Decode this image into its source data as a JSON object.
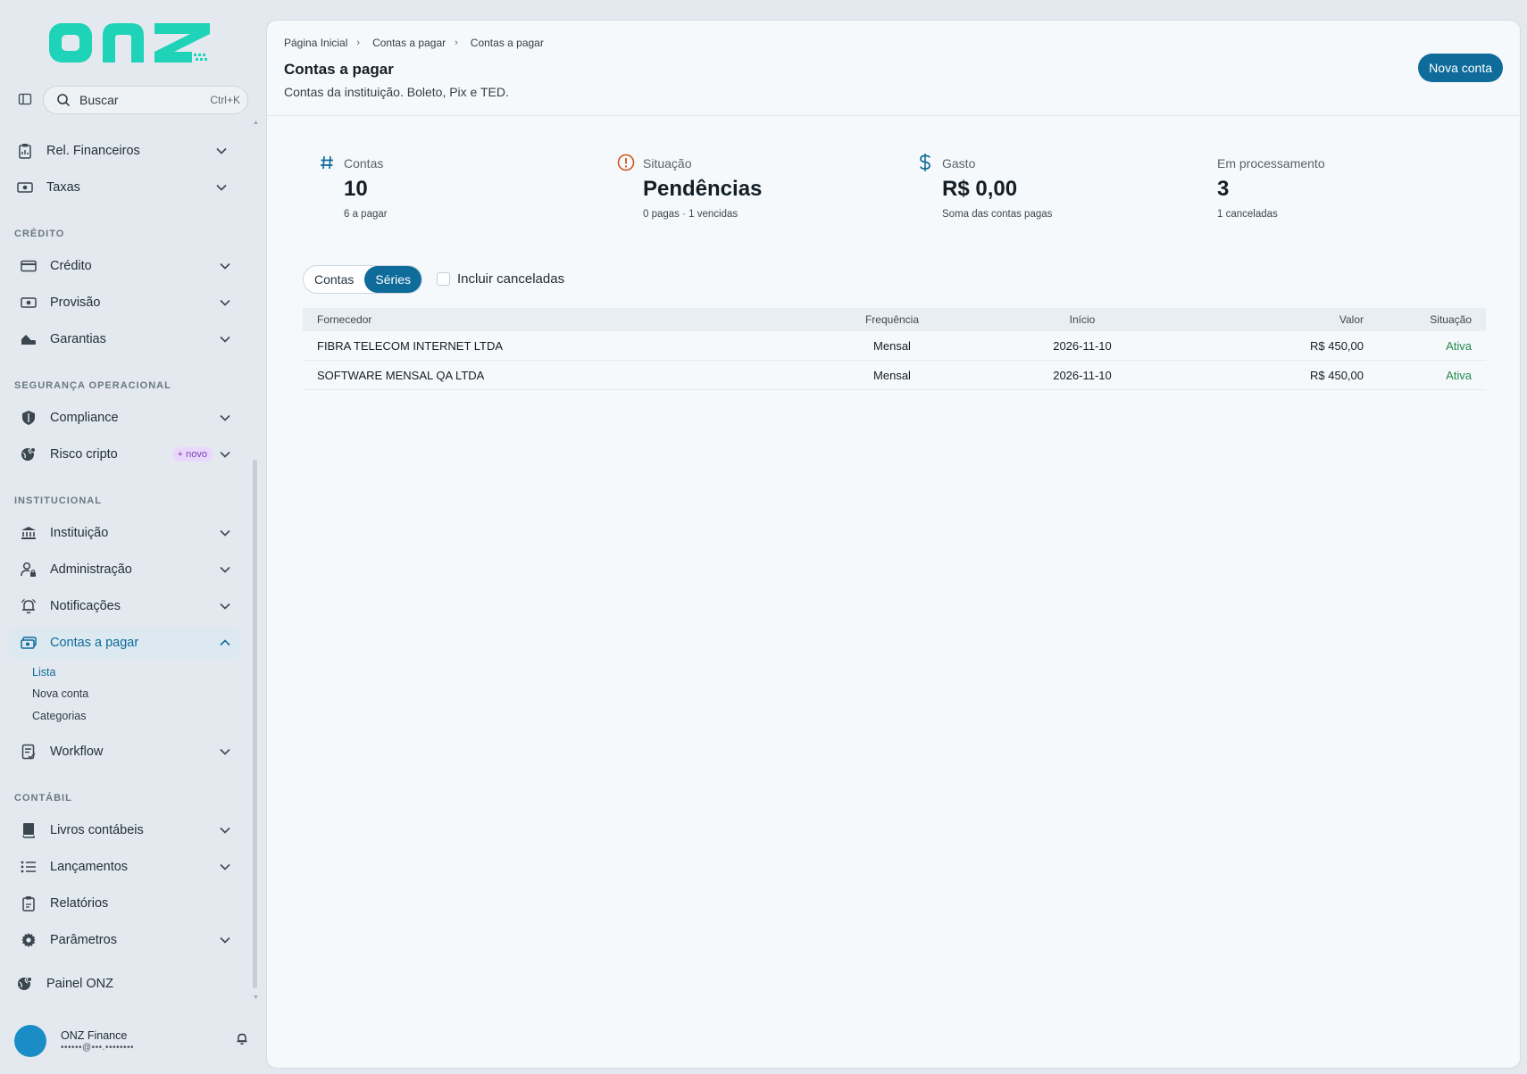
{
  "brand": {
    "logo_text": "onz",
    "accent": "#1fd3b9"
  },
  "search": {
    "label": "Buscar",
    "shortcut": "Ctrl+K"
  },
  "sidebar": {
    "items": [
      {
        "label": "Rel. Financeiros",
        "icon": "report-icon"
      },
      {
        "label": "Taxas",
        "icon": "money-icon"
      },
      {
        "label": "Crédito",
        "icon": "card-icon"
      },
      {
        "label": "Provisão",
        "icon": "money-icon"
      },
      {
        "label": "Garantias",
        "icon": "car-home-icon"
      },
      {
        "label": "Compliance",
        "icon": "shield-icon"
      },
      {
        "label": "Risco cripto",
        "icon": "globe-icon",
        "badge": "+ novo"
      },
      {
        "label": "Instituição",
        "icon": "bank-icon"
      },
      {
        "label": "Administração",
        "icon": "user-lock-icon"
      },
      {
        "label": "Notificações",
        "icon": "bell-icon"
      },
      {
        "label": "Contas a pagar",
        "icon": "bill-icon"
      },
      {
        "label": "Workflow",
        "icon": "checklist-icon"
      },
      {
        "label": "Livros contábeis",
        "icon": "book-icon"
      },
      {
        "label": "Lançamentos",
        "icon": "list-icon"
      },
      {
        "label": "Relatórios",
        "icon": "clipboard-icon"
      },
      {
        "label": "Parâmetros",
        "icon": "gear-icon"
      },
      {
        "label": "Painel ONZ",
        "icon": "globe-icon"
      }
    ],
    "sections": [
      "CRÉDITO",
      "SEGURANÇA OPERACIONAL",
      "INSTITUCIONAL",
      "CONTÁBIL"
    ],
    "sub_items": [
      "Lista",
      "Nova conta",
      "Categorias"
    ]
  },
  "user": {
    "name": "ONZ Finance",
    "email": "••••••@•••.••••••••"
  },
  "header": {
    "breadcrumb": [
      "Página Inicial",
      "Contas a pagar",
      "Contas a pagar"
    ],
    "title": "Contas a pagar",
    "subtitle": "Contas da instituição. Boleto, Pix e TED.",
    "primary_button": "Nova conta"
  },
  "stats": [
    {
      "label": "Contas",
      "value": "10",
      "note": "6 a pagar",
      "icon": "hash-icon",
      "color": "#0e6b9a"
    },
    {
      "label": "Situação",
      "value": "Pendências",
      "note": "0 pagas · 1 vencidas",
      "icon": "alert-icon",
      "color": "#d2531a"
    },
    {
      "label": "Gasto",
      "value": "R$ 0,00",
      "note": "Soma das contas pagas",
      "icon": "dollar-icon",
      "color": "#0e6b9a"
    },
    {
      "label": "Em processamento",
      "value": "3",
      "note": "1 canceladas"
    }
  ],
  "filters": {
    "tabs": [
      "Contas",
      "Séries"
    ],
    "active_tab": "Séries",
    "include_cancelled": {
      "label": "Incluir canceladas",
      "checked": false
    }
  },
  "table": {
    "columns": [
      "Fornecedor",
      "Frequência",
      "Início",
      "Valor",
      "Situação"
    ],
    "rows": [
      [
        "FIBRA TELECOM INTERNET LTDA",
        "Mensal",
        "2026-11-10",
        "R$ 450,00",
        "Ativa"
      ],
      [
        "SOFTWARE MENSAL QA LTDA",
        "Mensal",
        "2026-11-10",
        "R$ 450,00",
        "Ativa"
      ]
    ]
  }
}
